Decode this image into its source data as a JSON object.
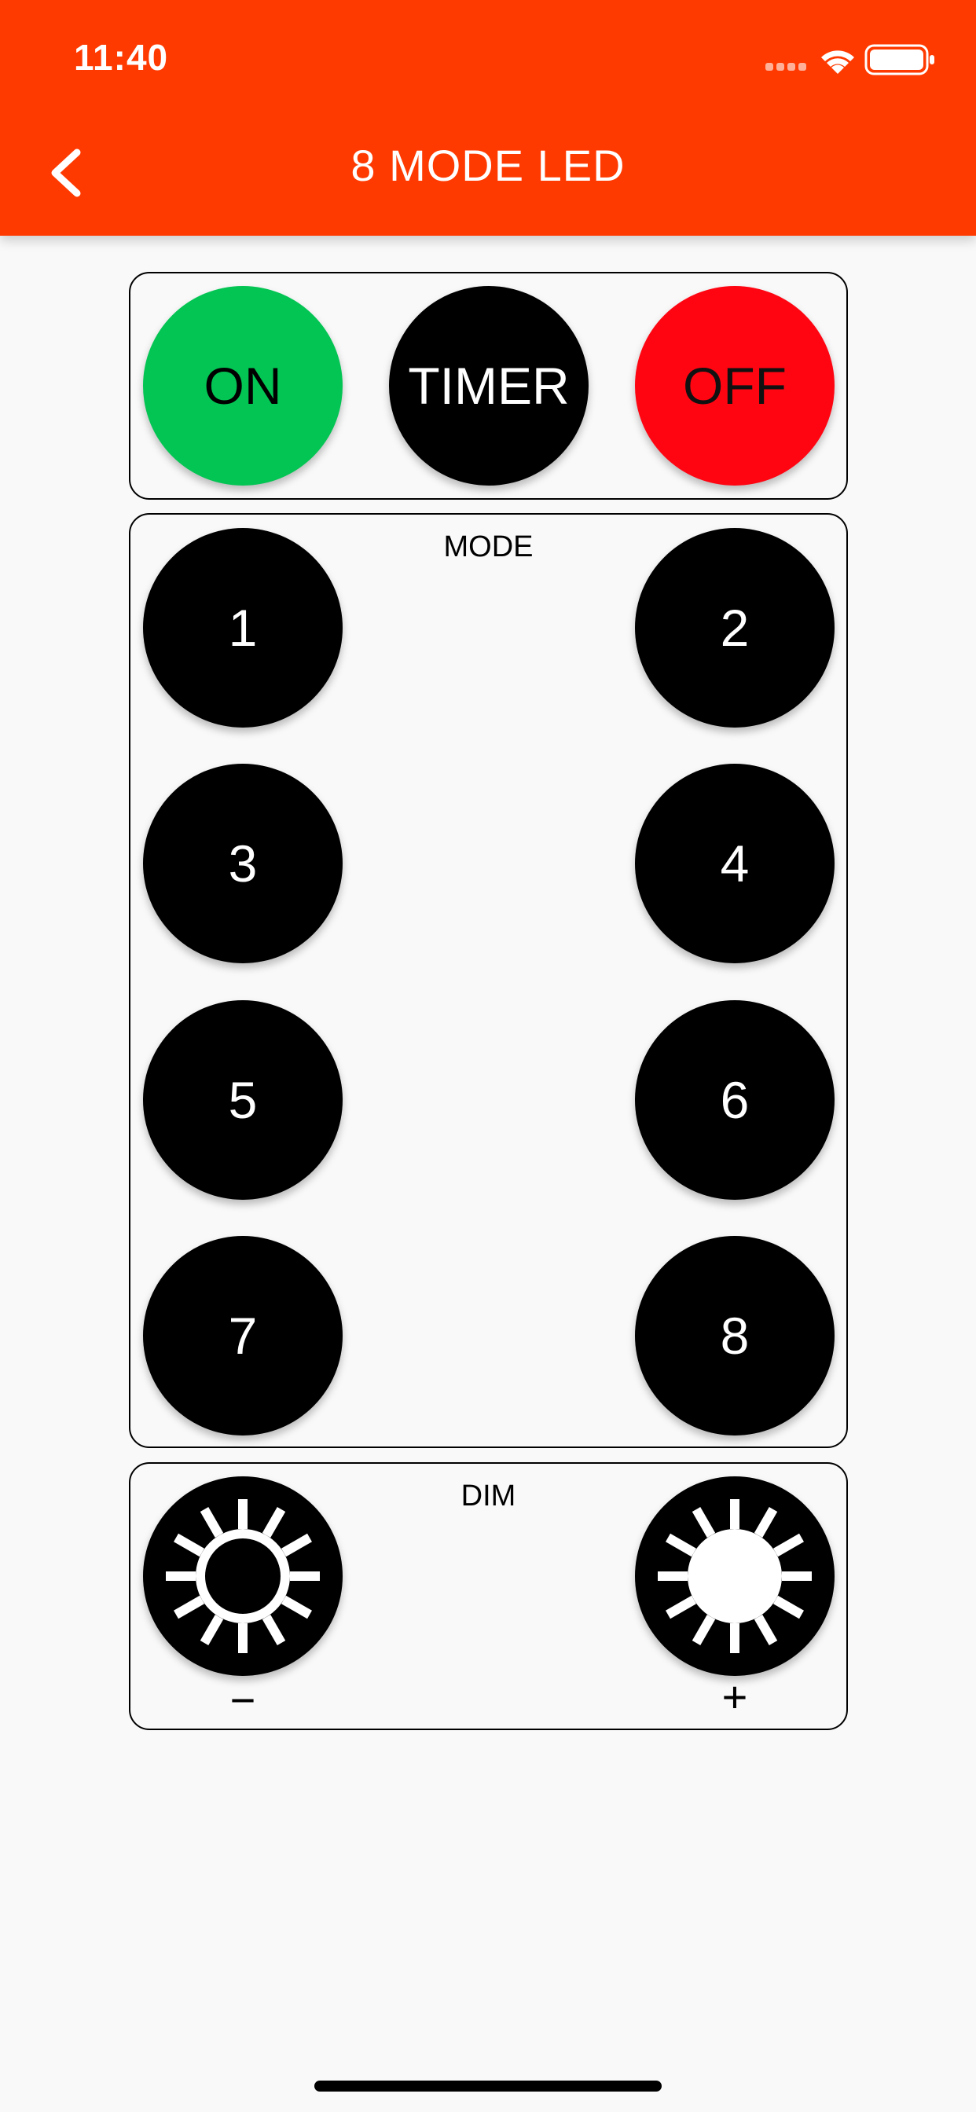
{
  "status_bar": {
    "time": "11:40",
    "icons": [
      "signal-dots-icon",
      "wifi-icon",
      "battery-icon"
    ]
  },
  "header": {
    "title": "8 MODE LED",
    "back_icon": "chevron-left-icon",
    "background": "#ff3a00"
  },
  "power": {
    "on_label": "ON",
    "timer_label": "TIMER",
    "off_label": "OFF",
    "on_color": "#03c553",
    "off_color": "#ff0512"
  },
  "mode": {
    "label": "MODE",
    "buttons": [
      "1",
      "2",
      "3",
      "4",
      "5",
      "6",
      "7",
      "8"
    ]
  },
  "dim": {
    "label": "DIM",
    "minus_label": "−",
    "plus_label": "+",
    "minus_icon": "sun-outline-icon",
    "plus_icon": "sun-filled-icon"
  }
}
